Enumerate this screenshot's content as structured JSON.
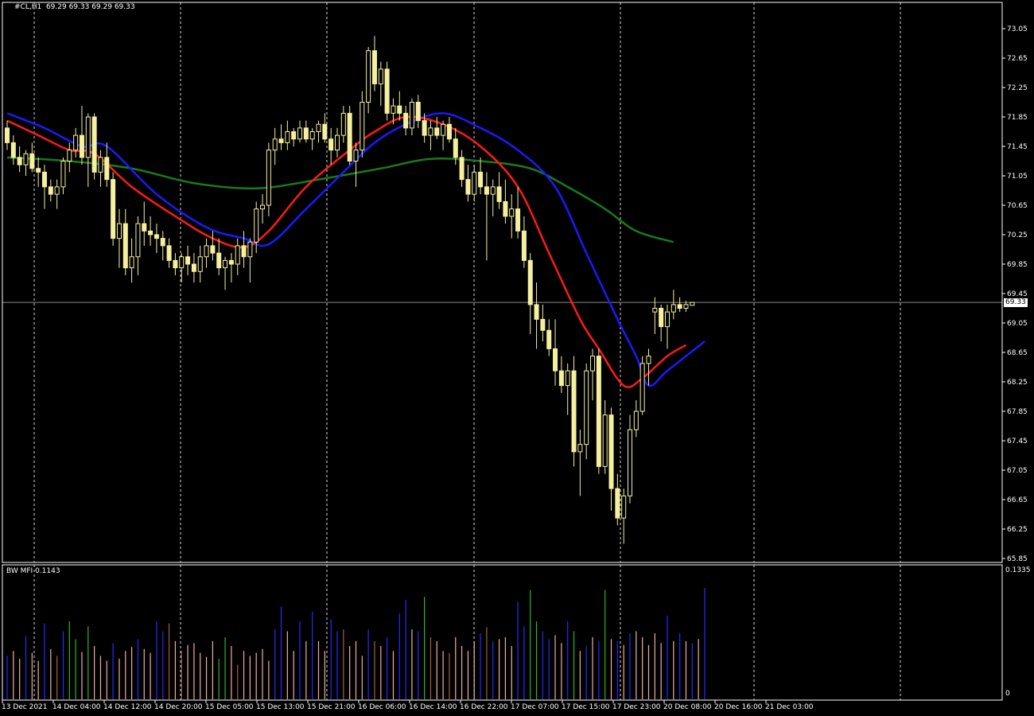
{
  "header": {
    "symbol": "#CL,H1",
    "ohlc": "69.29 69.33 69.29 69.33"
  },
  "indicator": {
    "label": "BW MFI",
    "value": "0.1143",
    "axis_max": "0.1335",
    "axis_min": "0"
  },
  "current_price": {
    "label": "69.33",
    "value": 69.33,
    "colors": {
      "line": "#8a8a8a",
      "badge_bg": "#ffffff",
      "badge_text": "#000000"
    }
  },
  "colors": {
    "background": "#000000",
    "frame": "#ffffff",
    "grid": "#ffffff",
    "candle": "#f5f0a0",
    "ma_fast": "#ff1a1a",
    "ma_mid": "#1a1aff",
    "ma_slow": "#1a7a1a",
    "mfi_blue": "#2a2aff",
    "mfi_green": "#2db52d",
    "mfi_pink": "#f0b0a0",
    "mfi_brown": "#a06048"
  },
  "chart_data": {
    "type": "candlestick",
    "price_axis": {
      "min": 65.85,
      "max": 73.05,
      "ticks": [
        "73.05",
        "72.65",
        "72.25",
        "71.85",
        "71.45",
        "71.05",
        "70.65",
        "70.25",
        "69.85",
        "69.45",
        "69.05",
        "68.65",
        "68.25",
        "67.85",
        "67.45",
        "67.05",
        "66.65",
        "66.25",
        "65.85"
      ]
    },
    "time_axis": {
      "labels": [
        "13 Dec 2021",
        "14 Dec 04:00",
        "14 Dec 12:00",
        "14 Dec 20:00",
        "15 Dec 05:00",
        "15 Dec 13:00",
        "15 Dec 21:00",
        "16 Dec 06:00",
        "16 Dec 14:00",
        "16 Dec 22:00",
        "17 Dec 07:00",
        "17 Dec 15:00",
        "17 Dec 23:00",
        "20 Dec 08:00",
        "20 Dec 16:00",
        "21 Dec 03:00"
      ]
    },
    "ohlc": [
      [
        71.7,
        71.8,
        71.4,
        71.5
      ],
      [
        71.5,
        71.6,
        71.2,
        71.3
      ],
      [
        71.3,
        71.45,
        71.1,
        71.2
      ],
      [
        71.2,
        71.4,
        71.05,
        71.35
      ],
      [
        71.35,
        71.5,
        71.1,
        71.15
      ],
      [
        71.15,
        71.3,
        70.9,
        71.1
      ],
      [
        71.1,
        71.2,
        70.6,
        70.9
      ],
      [
        70.9,
        71.0,
        70.7,
        70.8
      ],
      [
        70.8,
        71.0,
        70.6,
        70.9
      ],
      [
        70.9,
        71.3,
        70.8,
        71.25
      ],
      [
        71.25,
        71.5,
        71.1,
        71.4
      ],
      [
        71.4,
        71.7,
        71.3,
        71.6
      ],
      [
        71.6,
        72.0,
        71.2,
        71.3
      ],
      [
        71.3,
        71.9,
        70.9,
        71.85
      ],
      [
        71.85,
        71.9,
        71.0,
        71.1
      ],
      [
        71.1,
        71.4,
        70.9,
        71.3
      ],
      [
        71.3,
        71.5,
        70.9,
        71.0
      ],
      [
        71.0,
        71.1,
        70.1,
        70.2
      ],
      [
        70.2,
        70.6,
        69.8,
        70.4
      ],
      [
        70.4,
        70.6,
        69.7,
        69.8
      ],
      [
        69.8,
        70.2,
        69.6,
        69.95
      ],
      [
        69.95,
        70.5,
        69.7,
        70.4
      ],
      [
        70.4,
        70.7,
        70.1,
        70.3
      ],
      [
        70.3,
        70.5,
        70.1,
        70.25
      ],
      [
        70.25,
        70.4,
        70.0,
        70.2
      ],
      [
        70.2,
        70.3,
        69.9,
        70.1
      ],
      [
        70.1,
        70.2,
        69.8,
        69.9
      ],
      [
        69.9,
        70.0,
        69.7,
        69.8
      ],
      [
        69.8,
        70.0,
        69.6,
        69.95
      ],
      [
        69.95,
        70.1,
        69.7,
        69.85
      ],
      [
        69.85,
        70.0,
        69.6,
        69.75
      ],
      [
        69.75,
        70.1,
        69.6,
        69.95
      ],
      [
        69.95,
        70.2,
        69.8,
        70.1
      ],
      [
        70.1,
        70.3,
        69.9,
        70.0
      ],
      [
        70.0,
        70.2,
        69.7,
        69.8
      ],
      [
        69.8,
        69.95,
        69.5,
        69.9
      ],
      [
        69.9,
        70.0,
        69.6,
        69.85
      ],
      [
        69.85,
        70.2,
        69.7,
        70.1
      ],
      [
        70.1,
        70.3,
        69.8,
        69.95
      ],
      [
        69.95,
        70.2,
        69.6,
        70.15
      ],
      [
        70.15,
        70.7,
        70.0,
        70.6
      ],
      [
        70.6,
        70.8,
        70.4,
        70.65
      ],
      [
        70.65,
        71.5,
        70.5,
        71.4
      ],
      [
        71.4,
        71.7,
        71.2,
        71.55
      ],
      [
        71.55,
        71.75,
        71.4,
        71.5
      ],
      [
        71.5,
        71.8,
        71.4,
        71.65
      ],
      [
        71.65,
        71.7,
        71.45,
        71.55
      ],
      [
        71.55,
        71.8,
        71.5,
        71.7
      ],
      [
        71.7,
        71.8,
        71.5,
        71.55
      ],
      [
        71.55,
        71.7,
        71.4,
        71.65
      ],
      [
        71.65,
        71.8,
        71.5,
        71.75
      ],
      [
        71.75,
        71.9,
        71.5,
        71.55
      ],
      [
        71.55,
        71.7,
        71.2,
        71.4
      ],
      [
        71.4,
        71.7,
        71.3,
        71.6
      ],
      [
        71.6,
        72.0,
        71.5,
        71.9
      ],
      [
        71.9,
        72.0,
        71.2,
        71.25
      ],
      [
        71.25,
        71.5,
        70.9,
        71.4
      ],
      [
        71.4,
        72.2,
        71.3,
        72.05
      ],
      [
        72.05,
        72.8,
        71.9,
        72.75
      ],
      [
        72.75,
        72.95,
        72.2,
        72.3
      ],
      [
        72.3,
        72.6,
        72.0,
        72.5
      ],
      [
        72.5,
        72.6,
        71.8,
        71.9
      ],
      [
        71.9,
        72.1,
        71.75,
        72.0
      ],
      [
        72.0,
        72.2,
        71.8,
        71.9
      ],
      [
        71.9,
        72.0,
        71.6,
        71.7
      ],
      [
        71.7,
        72.1,
        71.6,
        72.05
      ],
      [
        72.05,
        72.15,
        71.7,
        71.8
      ],
      [
        71.8,
        71.9,
        71.5,
        71.6
      ],
      [
        71.6,
        71.8,
        71.4,
        71.7
      ],
      [
        71.7,
        71.85,
        71.55,
        71.6
      ],
      [
        71.6,
        71.8,
        71.4,
        71.75
      ],
      [
        71.75,
        71.85,
        71.5,
        71.55
      ],
      [
        71.55,
        71.7,
        71.2,
        71.3
      ],
      [
        71.3,
        71.4,
        70.9,
        71.0
      ],
      [
        71.0,
        71.2,
        70.7,
        70.8
      ],
      [
        70.8,
        71.2,
        70.7,
        71.1
      ],
      [
        71.1,
        71.3,
        70.8,
        70.9
      ],
      [
        70.9,
        71.1,
        69.9,
        70.8
      ],
      [
        70.8,
        71.0,
        70.5,
        70.9
      ],
      [
        70.9,
        71.1,
        70.6,
        70.7
      ],
      [
        70.7,
        71.0,
        70.4,
        70.5
      ],
      [
        70.5,
        70.8,
        70.2,
        70.6
      ],
      [
        70.6,
        70.9,
        70.2,
        70.3
      ],
      [
        70.3,
        70.5,
        69.8,
        69.9
      ],
      [
        69.9,
        70.0,
        68.9,
        69.3
      ],
      [
        69.3,
        69.6,
        68.7,
        69.1
      ],
      [
        69.1,
        69.3,
        68.8,
        68.95
      ],
      [
        68.95,
        69.1,
        68.6,
        68.7
      ],
      [
        68.7,
        69.1,
        68.2,
        68.4
      ],
      [
        68.4,
        68.6,
        68.1,
        68.2
      ],
      [
        68.2,
        68.5,
        67.8,
        68.4
      ],
      [
        68.4,
        68.6,
        67.1,
        67.3
      ],
      [
        67.3,
        67.6,
        66.7,
        67.4
      ],
      [
        67.4,
        68.5,
        67.2,
        68.4
      ],
      [
        68.4,
        68.7,
        68.0,
        68.6
      ],
      [
        68.6,
        68.7,
        67.0,
        67.1
      ],
      [
        67.1,
        68.0,
        67.0,
        67.8
      ],
      [
        67.8,
        67.9,
        66.5,
        66.8
      ],
      [
        66.8,
        67.0,
        66.3,
        66.4
      ],
      [
        66.4,
        66.8,
        66.05,
        66.7
      ],
      [
        66.7,
        67.8,
        66.6,
        67.6
      ],
      [
        67.6,
        68.0,
        67.5,
        67.85
      ],
      [
        67.85,
        68.6,
        67.8,
        68.5
      ],
      [
        68.5,
        68.7,
        68.2,
        68.6
      ],
      [
        69.2,
        69.4,
        68.9,
        69.25
      ],
      [
        69.25,
        69.3,
        68.8,
        69.0
      ],
      [
        69.0,
        69.3,
        68.7,
        69.2
      ],
      [
        69.2,
        69.5,
        69.1,
        69.3
      ],
      [
        69.3,
        69.4,
        69.2,
        69.25
      ],
      [
        69.25,
        69.35,
        69.2,
        69.3
      ],
      [
        69.29,
        69.33,
        69.29,
        69.33
      ]
    ],
    "ma_fast_anchors": [
      [
        0,
        71.8
      ],
      [
        5,
        71.6
      ],
      [
        10,
        71.4
      ],
      [
        14,
        71.35
      ],
      [
        20,
        70.9
      ],
      [
        27,
        70.5
      ],
      [
        33,
        70.2
      ],
      [
        38,
        70.08
      ],
      [
        42,
        70.3
      ],
      [
        48,
        70.9
      ],
      [
        55,
        71.4
      ],
      [
        59,
        71.65
      ],
      [
        64,
        71.85
      ],
      [
        70,
        71.75
      ],
      [
        76,
        71.45
      ],
      [
        82,
        70.9
      ],
      [
        87,
        70.0
      ],
      [
        92,
        69.1
      ],
      [
        95,
        68.7
      ],
      [
        99,
        68.2
      ],
      [
        102,
        68.3
      ],
      [
        106,
        68.6
      ],
      [
        109,
        68.75
      ]
    ],
    "ma_mid_anchors": [
      [
        0,
        71.9
      ],
      [
        6,
        71.7
      ],
      [
        12,
        71.45
      ],
      [
        16,
        71.45
      ],
      [
        24,
        70.8
      ],
      [
        32,
        70.35
      ],
      [
        38,
        70.2
      ],
      [
        42,
        70.12
      ],
      [
        48,
        70.6
      ],
      [
        54,
        71.1
      ],
      [
        59,
        71.5
      ],
      [
        64,
        71.75
      ],
      [
        70,
        71.9
      ],
      [
        76,
        71.7
      ],
      [
        82,
        71.4
      ],
      [
        88,
        70.9
      ],
      [
        93,
        70.0
      ],
      [
        98,
        69.1
      ],
      [
        101,
        68.6
      ],
      [
        103,
        68.2
      ],
      [
        106,
        68.4
      ],
      [
        112,
        68.8
      ]
    ],
    "ma_slow_anchors": [
      [
        0,
        71.3
      ],
      [
        10,
        71.25
      ],
      [
        20,
        71.15
      ],
      [
        30,
        70.95
      ],
      [
        40,
        70.88
      ],
      [
        50,
        71.0
      ],
      [
        60,
        71.15
      ],
      [
        68,
        71.28
      ],
      [
        76,
        71.25
      ],
      [
        84,
        71.15
      ],
      [
        90,
        70.9
      ],
      [
        96,
        70.6
      ],
      [
        101,
        70.3
      ],
      [
        107,
        70.15
      ]
    ],
    "mfi": [
      [
        0.045,
        "blue"
      ],
      [
        0.05,
        "pink"
      ],
      [
        0.042,
        "pink"
      ],
      [
        0.065,
        "blue"
      ],
      [
        0.048,
        "pink"
      ],
      [
        0.04,
        "pink"
      ],
      [
        0.078,
        "blue"
      ],
      [
        0.052,
        "pink"
      ],
      [
        0.045,
        "brown"
      ],
      [
        0.07,
        "blue"
      ],
      [
        0.08,
        "green"
      ],
      [
        0.062,
        "green"
      ],
      [
        0.049,
        "pink"
      ],
      [
        0.075,
        "green"
      ],
      [
        0.055,
        "pink"
      ],
      [
        0.045,
        "pink"
      ],
      [
        0.04,
        "pink"
      ],
      [
        0.058,
        "blue"
      ],
      [
        0.042,
        "pink"
      ],
      [
        0.05,
        "pink"
      ],
      [
        0.054,
        "pink"
      ],
      [
        0.062,
        "blue"
      ],
      [
        0.052,
        "pink"
      ],
      [
        0.048,
        "pink"
      ],
      [
        0.08,
        "blue"
      ],
      [
        0.07,
        "blue"
      ],
      [
        0.078,
        "brown"
      ],
      [
        0.06,
        "pink"
      ],
      [
        0.05,
        "brown"
      ],
      [
        0.056,
        "pink"
      ],
      [
        0.058,
        "pink"
      ],
      [
        0.048,
        "pink"
      ],
      [
        0.044,
        "pink"
      ],
      [
        0.06,
        "pink"
      ],
      [
        0.042,
        "green"
      ],
      [
        0.064,
        "green"
      ],
      [
        0.055,
        "pink"
      ],
      [
        0.036,
        "brown"
      ],
      [
        0.05,
        "pink"
      ],
      [
        0.045,
        "pink"
      ],
      [
        0.048,
        "pink"
      ],
      [
        0.052,
        "pink"
      ],
      [
        0.04,
        "pink"
      ],
      [
        0.072,
        "blue"
      ],
      [
        0.095,
        "blue"
      ],
      [
        0.07,
        "pink"
      ],
      [
        0.05,
        "pink"
      ],
      [
        0.08,
        "blue"
      ],
      [
        0.06,
        "pink"
      ],
      [
        0.09,
        "blue"
      ],
      [
        0.06,
        "pink"
      ],
      [
        0.05,
        "pink"
      ],
      [
        0.082,
        "blue"
      ],
      [
        0.07,
        "blue"
      ],
      [
        0.072,
        "brown"
      ],
      [
        0.055,
        "pink"
      ],
      [
        0.06,
        "pink"
      ],
      [
        0.045,
        "pink"
      ],
      [
        0.072,
        "blue"
      ],
      [
        0.06,
        "brown"
      ],
      [
        0.055,
        "pink"
      ],
      [
        0.064,
        "blue"
      ],
      [
        0.05,
        "pink"
      ],
      [
        0.088,
        "blue"
      ],
      [
        0.102,
        "blue"
      ],
      [
        0.072,
        "pink"
      ],
      [
        0.07,
        "blue"
      ],
      [
        0.105,
        "green"
      ],
      [
        0.064,
        "brown"
      ],
      [
        0.06,
        "pink"
      ],
      [
        0.05,
        "pink"
      ],
      [
        0.048,
        "brown"
      ],
      [
        0.064,
        "pink"
      ],
      [
        0.055,
        "pink"
      ],
      [
        0.05,
        "pink"
      ],
      [
        0.06,
        "pink"
      ],
      [
        0.068,
        "blue"
      ],
      [
        0.074,
        "brown"
      ],
      [
        0.06,
        "blue"
      ],
      [
        0.062,
        "pink"
      ],
      [
        0.064,
        "pink"
      ],
      [
        0.055,
        "pink"
      ],
      [
        0.1,
        "blue"
      ],
      [
        0.075,
        "blue"
      ],
      [
        0.112,
        "green"
      ],
      [
        0.08,
        "green"
      ],
      [
        0.07,
        "blue"
      ],
      [
        0.062,
        "blue"
      ],
      [
        0.066,
        "pink"
      ],
      [
        0.058,
        "pink"
      ],
      [
        0.08,
        "blue"
      ],
      [
        0.07,
        "green"
      ],
      [
        0.05,
        "pink"
      ],
      [
        0.055,
        "blue"
      ],
      [
        0.064,
        "pink"
      ],
      [
        0.06,
        "blue"
      ],
      [
        0.112,
        "green"
      ],
      [
        0.062,
        "pink"
      ],
      [
        0.06,
        "blue"
      ],
      [
        0.056,
        "pink"
      ],
      [
        0.068,
        "blue"
      ],
      [
        0.07,
        "pink"
      ],
      [
        0.064,
        "pink"
      ],
      [
        0.056,
        "pink"
      ],
      [
        0.068,
        "pink"
      ],
      [
        0.058,
        "pink"
      ],
      [
        0.086,
        "blue"
      ],
      [
        0.06,
        "pink"
      ],
      [
        0.068,
        "blue"
      ],
      [
        0.06,
        "pink"
      ],
      [
        0.058,
        "blue"
      ],
      [
        0.062,
        "pink"
      ],
      [
        0.114,
        "blue"
      ]
    ]
  }
}
